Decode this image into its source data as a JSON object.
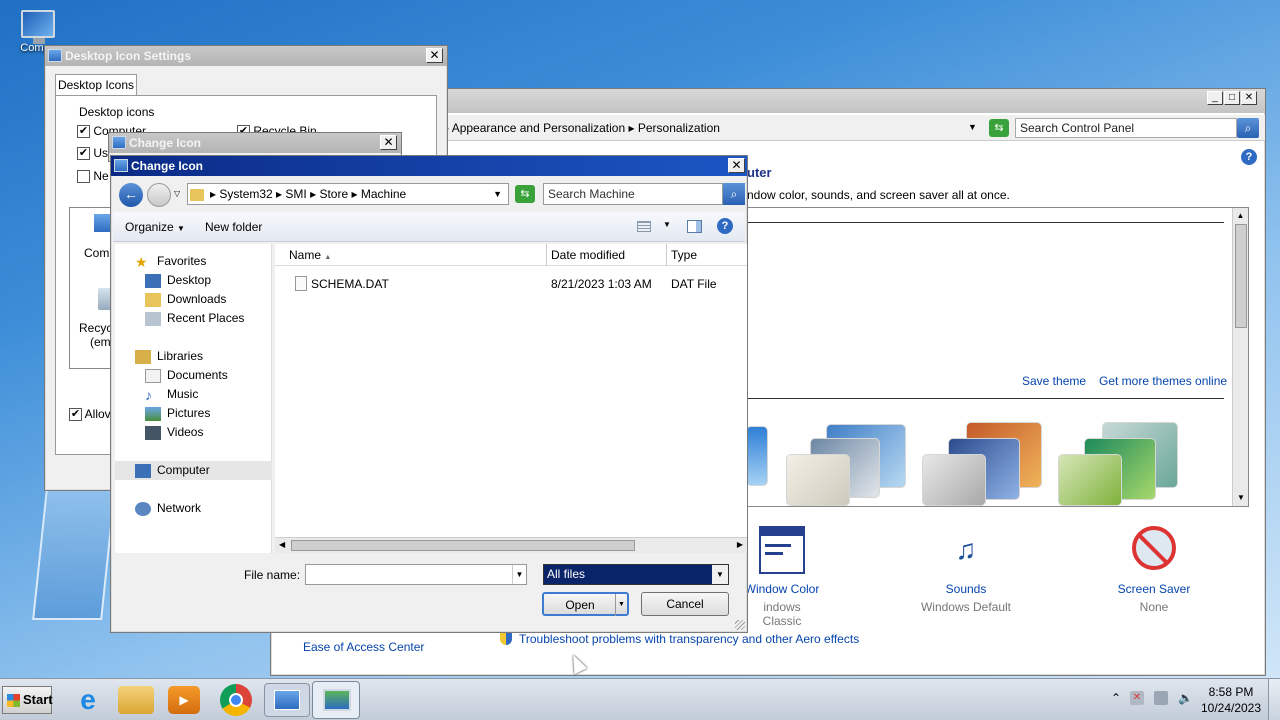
{
  "desktop": {
    "icon_label": "Computer",
    "icon_label_clipped": "Compu"
  },
  "control_panel": {
    "breadcrumb": [
      "Appearance and Personalization",
      "Personalization"
    ],
    "search_placeholder": "Search Control Panel",
    "heading_fragment": "uter",
    "description_fragment": "ndow color, sounds, and screen saver all at once.",
    "save_theme": "Save theme",
    "get_more_themes": "Get more themes online",
    "items": [
      {
        "label": "Window Color",
        "sub": "indows Classic",
        "icon": "window-color-icon"
      },
      {
        "label": "Sounds",
        "sub": "Windows Default",
        "icon": "sounds-icon"
      },
      {
        "label": "Screen Saver",
        "sub": "None",
        "icon": "screen-saver-icon"
      }
    ],
    "see_also_link": "Ease of Access Center",
    "troubleshoot_link": "Troubleshoot problems with transparency and other Aero effects"
  },
  "desktop_icon_settings": {
    "title": "Desktop Icon Settings",
    "tab": "Desktop Icons",
    "group_label": "Desktop icons",
    "checkboxes": [
      {
        "label": "Computer",
        "checked": true
      },
      {
        "label": "Recycle Bin",
        "checked": true
      },
      {
        "label": "Us",
        "checked": true
      },
      {
        "label": "Ne",
        "checked": false
      }
    ],
    "icon_labels": [
      "Comp",
      "Recyc",
      "(emp"
    ],
    "allow_label": "Allov"
  },
  "change_icon_bg": {
    "title": "Change Icon"
  },
  "file_dialog": {
    "title": "Change Icon",
    "path": [
      "System32",
      "SMI",
      "Store",
      "Machine"
    ],
    "search_placeholder": "Search Machine",
    "toolbar": {
      "organize": "Organize",
      "new_folder": "New folder"
    },
    "nav": {
      "favorites": "Favorites",
      "favorites_items": [
        "Desktop",
        "Downloads",
        "Recent Places"
      ],
      "libraries": "Libraries",
      "libraries_items": [
        "Documents",
        "Music",
        "Pictures",
        "Videos"
      ],
      "computer": "Computer",
      "network": "Network"
    },
    "columns": {
      "name": "Name",
      "date": "Date modified",
      "type": "Type"
    },
    "files": [
      {
        "name": "SCHEMA.DAT",
        "date": "8/21/2023 1:03 AM",
        "type": "DAT File"
      }
    ],
    "file_name_label": "File name:",
    "file_name_value": "",
    "filter": "All files",
    "open": "Open",
    "cancel": "Cancel"
  },
  "taskbar": {
    "start": "Start",
    "time": "8:58 PM",
    "date": "10/24/2023"
  }
}
